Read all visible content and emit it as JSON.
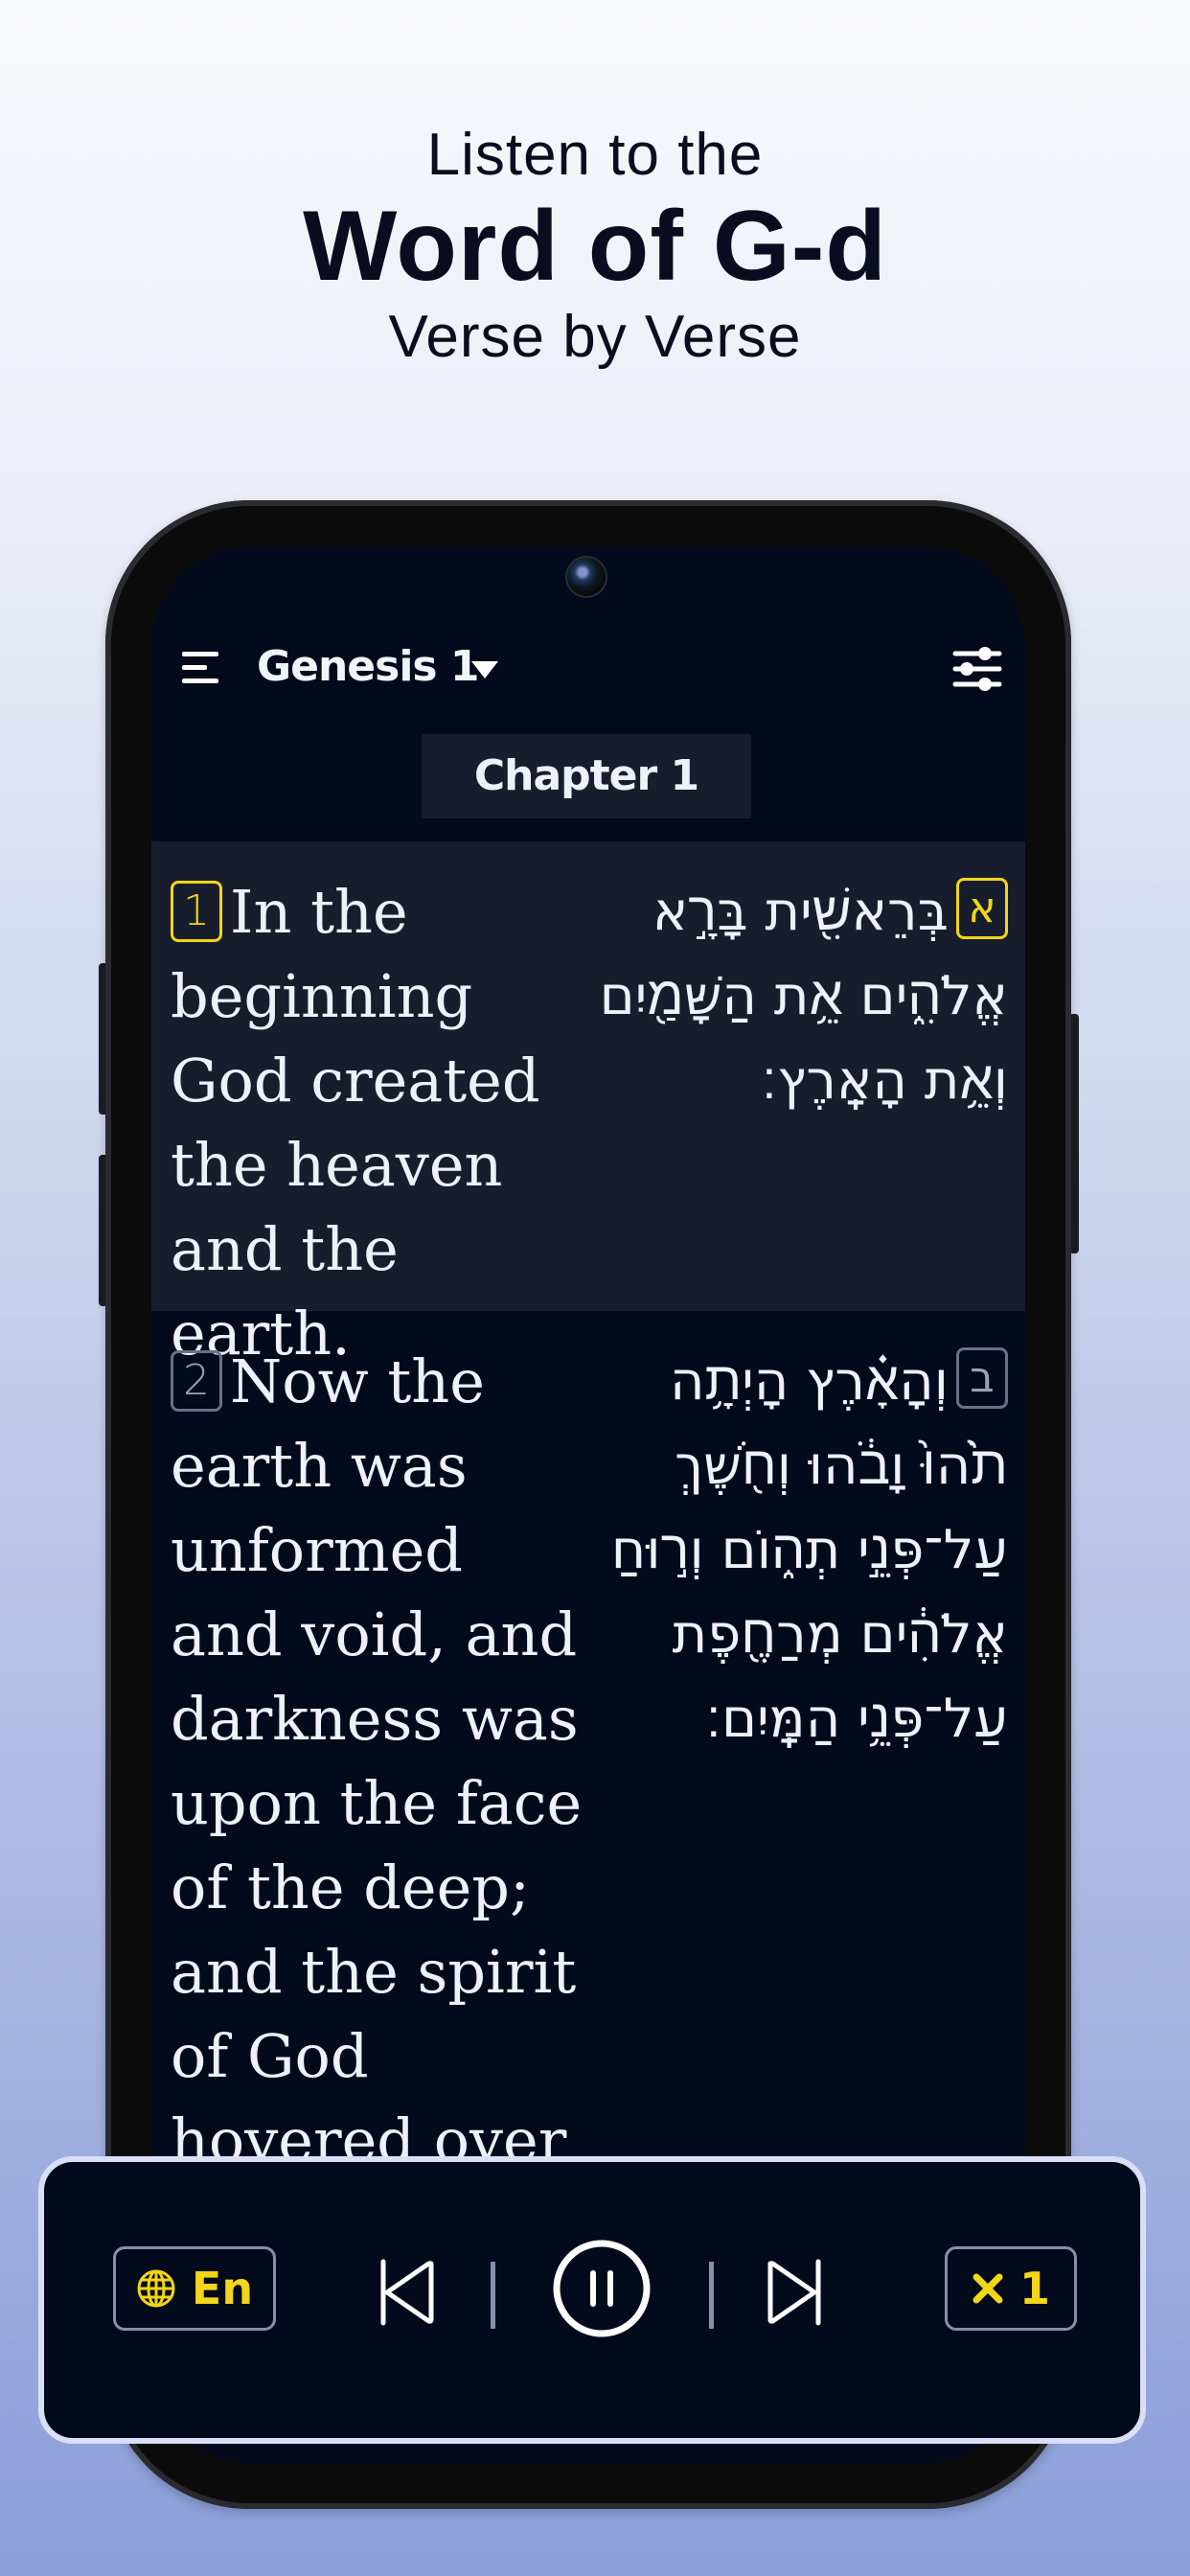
{
  "headline": {
    "line1": "Listen to the",
    "line2": "Word of G-d",
    "line3": "Verse by Verse"
  },
  "toolbar": {
    "menu_icon": "hamburger-menu-icon",
    "book_title": "Genesis 1",
    "dropdown_icon": "caret-down-icon",
    "settings_icon": "sliders-icon"
  },
  "chapter_label": "Chapter 1",
  "verses": [
    {
      "number": "1",
      "hebrew_number": "א",
      "english": "In the beginning God created the heaven and the earth.",
      "hebrew": "בְּרֵאשִׁ֖ית בָּרָ֣א אֱלֹהִ֑ים אֵ֥ת הַשָּׁמַ֖יִם וְאֵ֥ת הָאָֽרֶץ׃",
      "active": true
    },
    {
      "number": "2",
      "hebrew_number": "ב",
      "english": "Now the earth was unformed and void, and darkness was upon the face of the deep; and the spirit of God hovered over",
      "hebrew": "וְהָאָ֗רֶץ הָיְתָ֥ה תֹ֙הוּ֙ וָבֹ֔הוּ וְחֹ֖שֶׁךְ עַל־פְּנֵ֣י תְה֑וֹם וְר֣וּחַ אֱלֹהִ֔ים מְרַחֶ֖פֶת עַל־פְּנֵ֥י הַמָּֽיִם׃",
      "active": false
    }
  ],
  "player": {
    "language_label": "En",
    "language_icon": "globe-icon",
    "prev_icon": "skip-previous-icon",
    "pause_icon": "pause-circle-icon",
    "next_icon": "skip-next-icon",
    "speed_label": "1",
    "speed_icon": "multiply-icon",
    "state": "playing"
  },
  "colors": {
    "accent": "#f3d519",
    "screen_bg": "#030a1c",
    "active_verse_bg": "#181d2e",
    "text": "#eef0fa"
  }
}
